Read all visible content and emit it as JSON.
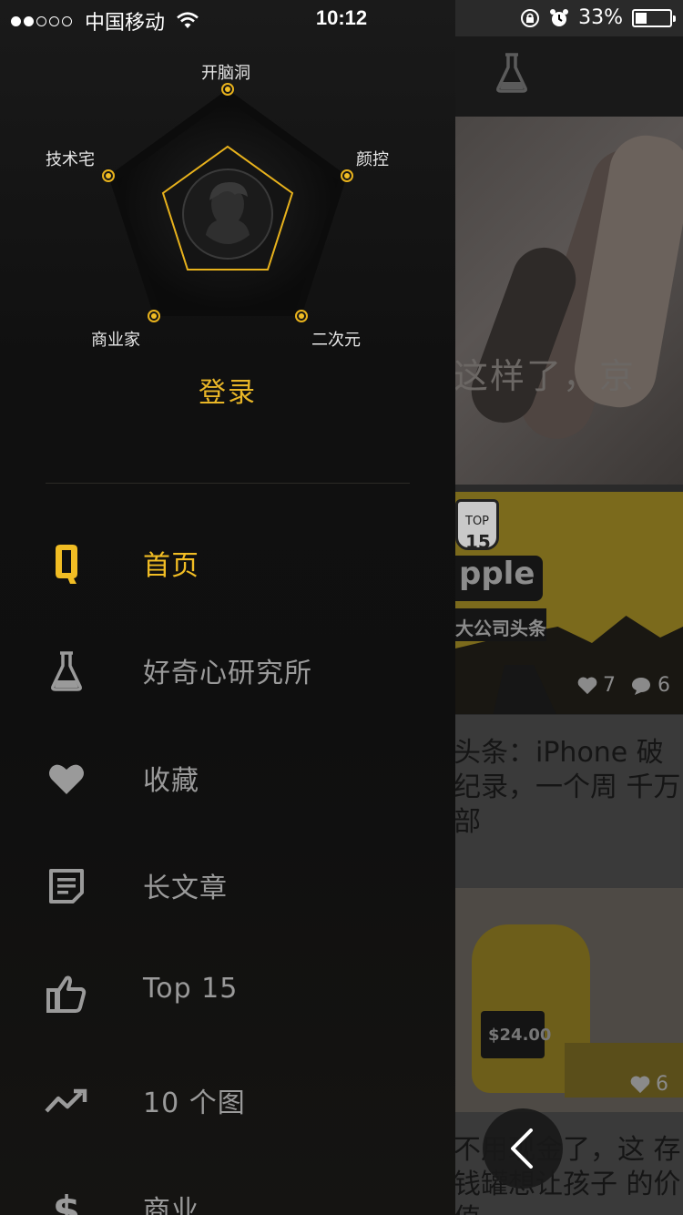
{
  "status_bar": {
    "carrier": "中国移动",
    "time": "10:12",
    "battery": "33%",
    "battery_level": 0.33
  },
  "feed": {
    "card1_title": "这样了，京",
    "card2_sign": "pple",
    "card2_badge_top": "TOP",
    "card2_badge_num": "15",
    "card2_banner": "大公司头条",
    "card2_likes": "7",
    "card2_comments": "6",
    "card2_title": "头条：iPhone 破纪录，一个周 千万部",
    "card3_price": "$24.00",
    "card3_likes": "6",
    "card3_title": "不用现金了，这 存钱罐想让孩子 的价值"
  },
  "radar": {
    "labels": {
      "top": "开脑洞",
      "right": "颜控",
      "bottom_right": "二次元",
      "bottom_left": "商业家",
      "left": "技术宅"
    },
    "accent_color": "#e8b21c"
  },
  "login_label": "登录",
  "menu": [
    {
      "label": "首页",
      "icon": "q-logo-icon",
      "active": true
    },
    {
      "label": "好奇心研究所",
      "icon": "lab-flask-icon",
      "active": false
    },
    {
      "label": "收藏",
      "icon": "heart-icon",
      "active": false
    },
    {
      "label": "长文章",
      "icon": "article-icon",
      "active": false
    },
    {
      "label": "Top 15",
      "icon": "thumbs-up-icon",
      "active": false
    },
    {
      "label": "10 个图",
      "icon": "trend-icon",
      "active": false
    },
    {
      "label": "商业",
      "icon": "dollar-icon",
      "active": false
    }
  ],
  "colors": {
    "accent": "#f1bd24",
    "menu_text": "#9a9a9a",
    "drawer_bg": "#111111"
  }
}
